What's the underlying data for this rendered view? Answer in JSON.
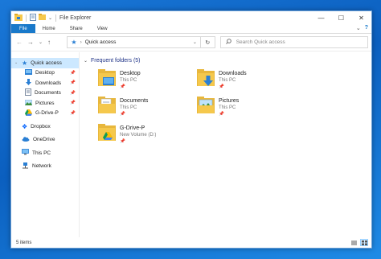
{
  "window": {
    "title": "File Explorer",
    "controls": [
      "minimize-icon",
      "maximize-icon",
      "close-icon"
    ]
  },
  "ribbon": {
    "tabs": [
      "File",
      "Home",
      "Share",
      "View"
    ]
  },
  "address": {
    "crumb": "Quick access",
    "search_placeholder": "Search Quick access"
  },
  "sidebar": {
    "items": [
      {
        "label": "Quick access",
        "icon": "star-icon",
        "active": true
      },
      {
        "label": "Desktop",
        "icon": "desktop-folder-icon",
        "pinned": true
      },
      {
        "label": "Downloads",
        "icon": "downloads-folder-icon",
        "pinned": true
      },
      {
        "label": "Documents",
        "icon": "documents-folder-icon",
        "pinned": true
      },
      {
        "label": "Pictures",
        "icon": "pictures-folder-icon",
        "pinned": true
      },
      {
        "label": "G-Drive-P",
        "icon": "google-drive-icon",
        "pinned": true
      },
      {
        "label": "Dropbox",
        "icon": "dropbox-icon"
      },
      {
        "label": "OneDrive",
        "icon": "onedrive-icon"
      },
      {
        "label": "This PC",
        "icon": "this-pc-icon"
      },
      {
        "label": "Network",
        "icon": "network-icon"
      }
    ]
  },
  "main": {
    "group_title": "Frequent folders (5)",
    "folders": [
      {
        "name": "Desktop",
        "location": "This PC",
        "icon": "desktop-folder-icon"
      },
      {
        "name": "Downloads",
        "location": "This PC",
        "icon": "downloads-folder-icon"
      },
      {
        "name": "Documents",
        "location": "This PC",
        "icon": "documents-folder-icon"
      },
      {
        "name": "Pictures",
        "location": "This PC",
        "icon": "pictures-folder-icon"
      },
      {
        "name": "G-Drive-P",
        "location": "New Volume (D:)",
        "icon": "google-drive-folder-icon"
      }
    ]
  },
  "status": {
    "item_count": "5 items"
  },
  "colors": {
    "accent": "#1979ca",
    "folder": "#f5c84c",
    "selection": "#cce8ff",
    "group_title": "#1e3287"
  }
}
